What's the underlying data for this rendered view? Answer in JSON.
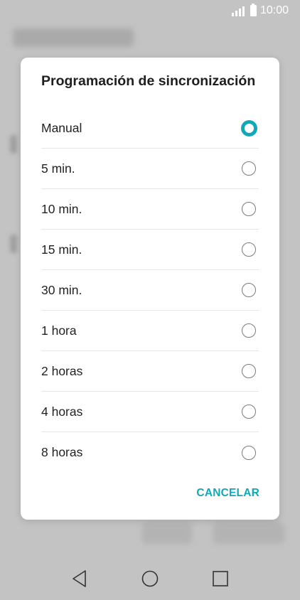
{
  "status_bar": {
    "time": "10:00",
    "icons": [
      "signal-icon",
      "battery-icon"
    ]
  },
  "dialog": {
    "title": "Programación de sincronización",
    "options": [
      {
        "label": "Manual",
        "selected": true
      },
      {
        "label": "5 min.",
        "selected": false
      },
      {
        "label": "10 min.",
        "selected": false
      },
      {
        "label": "15 min.",
        "selected": false
      },
      {
        "label": "30 min.",
        "selected": false
      },
      {
        "label": "1 hora",
        "selected": false
      },
      {
        "label": "2 horas",
        "selected": false
      },
      {
        "label": "4 horas",
        "selected": false
      },
      {
        "label": "8 horas",
        "selected": false
      }
    ],
    "cancel_label": "CANCELAR",
    "accent_color": "#0fa9b7"
  },
  "nav_bar": {
    "icons": [
      "back-icon",
      "home-icon",
      "recent-apps-icon"
    ]
  }
}
